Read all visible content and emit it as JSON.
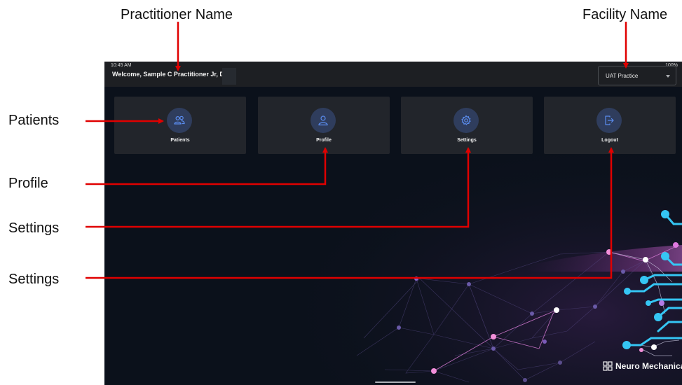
{
  "annotations": {
    "practitioner_name": "Practitioner Name",
    "facility_name": "Facility Name",
    "patients": "Patients",
    "profile": "Profile",
    "settings_1": "Settings",
    "settings_2": "Settings"
  },
  "status_bar": {
    "time": "10:45 AM",
    "battery": "100%"
  },
  "header": {
    "welcome": "Welcome, Sample C Practitioner Jr, D.C"
  },
  "facility_select": {
    "value": "UAT Practice"
  },
  "tiles": [
    {
      "label": "Patients",
      "icon": "users-icon"
    },
    {
      "label": "Profile",
      "icon": "user-icon"
    },
    {
      "label": "Settings",
      "icon": "gear-icon"
    },
    {
      "label": "Logout",
      "icon": "logout-icon"
    }
  ],
  "brand": {
    "name": "Neuro Mechanical"
  },
  "colors": {
    "annotation_red": "#e00000",
    "app_background": "#0b111b",
    "tile_background": "#22252b",
    "icon_circle": "#2f3d5d",
    "icon_stroke": "#5b8def",
    "network_cyan": "#35c6f4",
    "network_pink": "#f28fd9"
  }
}
